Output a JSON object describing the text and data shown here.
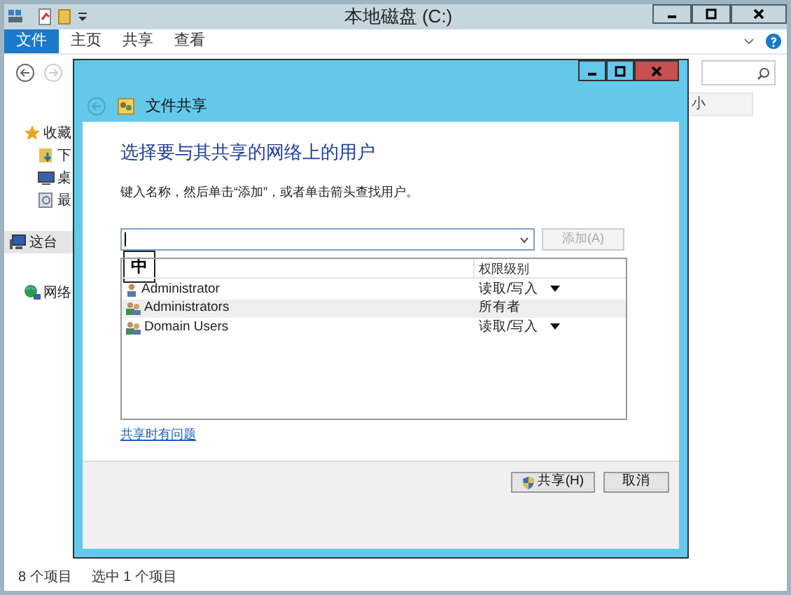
{
  "explorer": {
    "title": "本地磁盘 (C:)",
    "ribbon_tabs": [
      {
        "label": "文件",
        "selected": true
      },
      {
        "label": "主页",
        "selected": false
      },
      {
        "label": "共享",
        "selected": false
      },
      {
        "label": "查看",
        "selected": false
      }
    ],
    "sidebar": [
      {
        "label": "收藏",
        "kind": "star",
        "selected": false,
        "children": [
          {
            "label": "下",
            "kind": "download",
            "selected": false
          },
          {
            "label": "桌",
            "kind": "desktop",
            "selected": false
          },
          {
            "label": "最",
            "kind": "recent",
            "selected": false
          }
        ]
      },
      {
        "label": "这台",
        "kind": "computer",
        "selected": true
      },
      {
        "label": "网络",
        "kind": "network",
        "selected": false
      }
    ],
    "column_2": "小",
    "status_bar": [
      "8 个项目",
      "选中 1 个项目"
    ]
  },
  "dialog": {
    "title": "文件共享",
    "heading": "选择要与其共享的网络上的用户",
    "instruction": "键入名称，然后单击“添加”，或者单击箭头查找用户。",
    "add_button": {
      "label": "添加(A)",
      "disabled": true
    },
    "ime_indicator": "中",
    "permission_column": "权限级别",
    "rows": [
      {
        "name": "Administrator",
        "kind": "user",
        "permission": "读取/写入",
        "dropdown": true,
        "selected": false
      },
      {
        "name": "Administrators",
        "kind": "group",
        "permission": "所有者",
        "dropdown": false,
        "selected": true
      },
      {
        "name": "Domain Users",
        "kind": "group",
        "permission": "读取/写入",
        "dropdown": true,
        "selected": false
      }
    ],
    "help_link": "共享时有问题",
    "buttons": [
      {
        "label": "共享(H)",
        "kind": "shield"
      },
      {
        "label": "取消",
        "kind": "plain"
      }
    ]
  }
}
